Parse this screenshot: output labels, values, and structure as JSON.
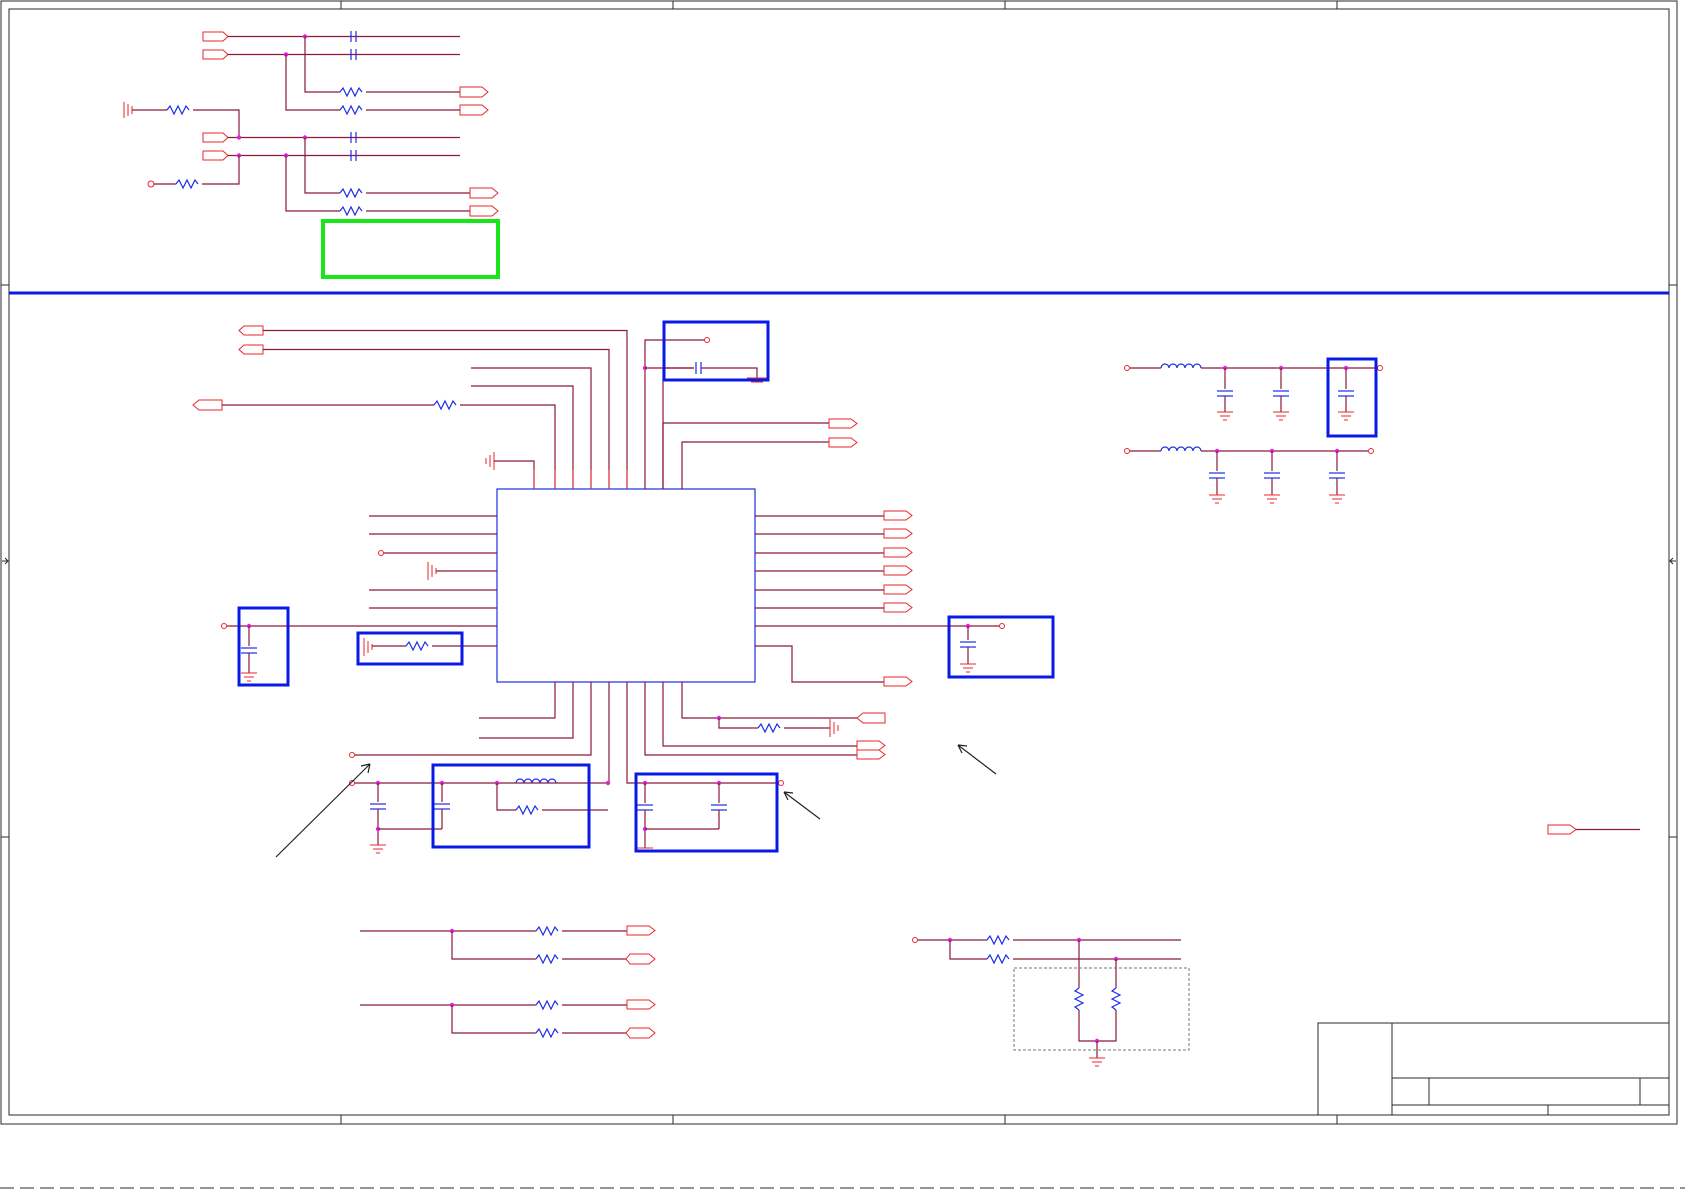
{
  "drawing": {
    "sheet_zones": "A–D by 1–5 grid",
    "title_block": {
      "fields": [
        "",
        "",
        "",
        "",
        ""
      ]
    }
  },
  "colors": {
    "wire": "#8b1a3a",
    "component": "#e8262d",
    "passive": "#1c2ee6",
    "junction": "#e020e0",
    "highlight_box": "#0a1ae6",
    "highlight_green": "#19e619"
  },
  "icons": [
    "resistor-icon",
    "capacitor-icon",
    "inductor-icon",
    "ground-icon",
    "port-icon",
    "junction-dot-icon",
    "arrow-icon"
  ]
}
